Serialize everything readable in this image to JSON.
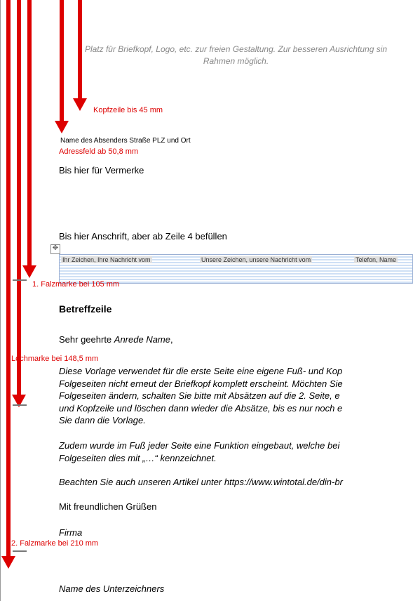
{
  "header": {
    "placeholder_line1": "Platz für Briefkopf, Logo, etc. zur freien Gestaltung. Zur besseren Ausrichtung sin",
    "placeholder_line2": "Rahmen möglich."
  },
  "annotations": {
    "kopfzeile": "Kopfzeile bis 45 mm",
    "adressfeld": "Adressfeld ab 50,8 mm",
    "falz1": "1. Falzmarke bei 105 mm",
    "lochmarke": "Lochmarke bei  148,5 mm",
    "falz2": "2. Falzmarke bei 210 mm"
  },
  "sender_line": "Name des Absenders    Straße  PLZ und Ort",
  "remarks_line": "Bis hier  für Vermerke",
  "address_line": "Bis hier Anschrift, aber ab Zeile 4 befüllen",
  "ref_labels": {
    "yours": "Ihr Zeichen, Ihre Nachricht vom",
    "ours": "Unsere Zeichen, unsere Nachricht vom",
    "phone": "Telefon, Name"
  },
  "body": {
    "subject": "Betreffzeile",
    "salutation_prefix": "Sehr geehrte ",
    "salutation_name": "Anrede Name",
    "salutation_suffix": ",",
    "p1": "Diese Vorlage verwendet für die erste Seite eine eigene Fuß- und Kop",
    "p2": "Folgeseiten nicht erneut der Briefkopf komplett erscheint. Möchten Sie",
    "p3": "Folgeseiten ändern, schalten Sie bitte mit Absätzen auf die 2. Seite, e",
    "p4": "und Kopfzeile und löschen dann wieder die Absätze, bis es nur noch e",
    "p5": "Sie dann die Vorlage.",
    "p6": "Zudem wurde im Fuß jeder Seite eine Funktion eingebaut, welche bei",
    "p7": "Folgeseiten dies mit „…“ kennzeichnet.",
    "p8": "Beachten Sie auch unseren Artikel unter https://www.wintotal.de/din-br",
    "closing": "Mit freundlichen Grüßen",
    "firma": "Firma",
    "signer": "Name des Unterzeichners"
  },
  "icons": {
    "move": "✥"
  }
}
